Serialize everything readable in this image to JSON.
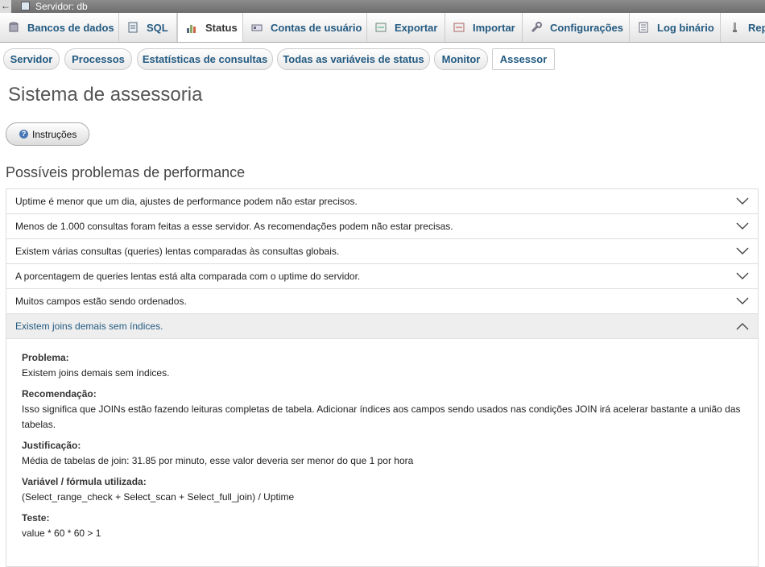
{
  "topbar": {
    "back_label": "←",
    "server_label": "Servidor: db"
  },
  "tabs": [
    {
      "label": "Bancos de dados",
      "icon": "database-icon"
    },
    {
      "label": "SQL",
      "icon": "sql-icon"
    },
    {
      "label": "Status",
      "icon": "status-chart-icon",
      "active": true
    },
    {
      "label": "Contas de usuário",
      "icon": "user-accounts-icon"
    },
    {
      "label": "Exportar",
      "icon": "export-icon"
    },
    {
      "label": "Importar",
      "icon": "import-icon"
    },
    {
      "label": "Configurações",
      "icon": "wrench-icon"
    },
    {
      "label": "Log binário",
      "icon": "binary-log-icon"
    },
    {
      "label": "Rep",
      "icon": "replication-icon"
    }
  ],
  "subtabs": [
    {
      "label": "Servidor"
    },
    {
      "label": "Processos"
    },
    {
      "label": "Estatísticas de consultas"
    },
    {
      "label": "Todas as variáveis de status"
    },
    {
      "label": "Monitor"
    },
    {
      "label": "Assessor",
      "active": true
    }
  ],
  "page_title": "Sistema de assessoria",
  "instructions_label": "Instruções",
  "section_title": "Possíveis problemas de performance",
  "rules": [
    {
      "text": "Uptime é menor que um dia, ajustes de performance podem não estar precisos."
    },
    {
      "text": "Menos de 1.000 consultas foram feitas a esse servidor. As recomendações podem não estar precisas."
    },
    {
      "text": "Existem várias consultas (queries) lentas comparadas às consultas globais."
    },
    {
      "text": "A porcentagem de queries lentas está alta comparada com o uptime do servidor."
    },
    {
      "text": "Muitos campos estão sendo ordenados."
    },
    {
      "text": "Existem joins demais sem índices.",
      "expanded": true
    }
  ],
  "details": {
    "problem_label": "Problema:",
    "problem": "Existem joins demais sem índices.",
    "recommendation_label": "Recomendação:",
    "recommendation": "Isso significa que JOINs estão fazendo leituras completas de tabela. Adicionar índices aos campos sendo usados nas condições JOIN irá acelerar bastante a união das tabelas.",
    "justification_label": "Justificação:",
    "justification": "Média de tabelas de join: 31.85 por minuto, esse valor deveria ser menor do que 1 por hora",
    "formula_label": "Variável / fórmula utilizada:",
    "formula": "(Select_range_check + Select_scan + Select_full_join) / Uptime",
    "test_label": "Teste:",
    "test": "value * 60 * 60 > 1"
  }
}
